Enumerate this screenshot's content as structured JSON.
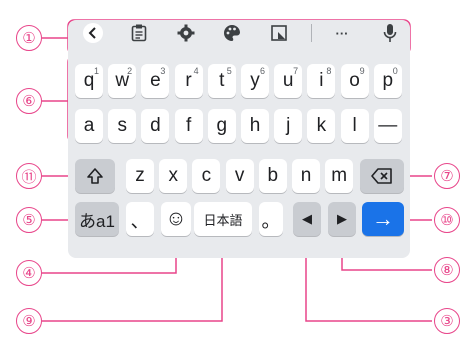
{
  "callouts": {
    "c1": "①",
    "c2": "⑥",
    "c3": "⑪",
    "c4": "⑤",
    "c5": "④",
    "c6": "⑨",
    "c7": "⑦",
    "c8": "⑩",
    "c9": "⑧",
    "c10": "③"
  },
  "toolbar": {
    "icons": [
      "back-chevron-icon",
      "clipboard-icon",
      "gear-icon",
      "palette-icon",
      "resize-icon",
      "more-icon",
      "mic-icon"
    ],
    "more_label": "···"
  },
  "row1": [
    {
      "label": "q",
      "hint": "1"
    },
    {
      "label": "w",
      "hint": "2"
    },
    {
      "label": "e",
      "hint": "3"
    },
    {
      "label": "r",
      "hint": "4"
    },
    {
      "label": "t",
      "hint": "5"
    },
    {
      "label": "y",
      "hint": "6"
    },
    {
      "label": "u",
      "hint": "7"
    },
    {
      "label": "i",
      "hint": "8"
    },
    {
      "label": "o",
      "hint": "9"
    },
    {
      "label": "p",
      "hint": "0"
    }
  ],
  "row2": [
    "a",
    "s",
    "d",
    "f",
    "g",
    "h",
    "j",
    "k",
    "l",
    "—"
  ],
  "row3": [
    "z",
    "x",
    "c",
    "v",
    "b",
    "n",
    "m"
  ],
  "row4": {
    "mode": "あa1",
    "comma": "、",
    "emoji": "☺",
    "language": "日本語",
    "period": "。",
    "left": "◀",
    "right": "▶",
    "enter": "→"
  },
  "colors": {
    "accent": "#e8458a",
    "enter": "#1a73e8",
    "keyboard_bg": "#e8eaed"
  }
}
